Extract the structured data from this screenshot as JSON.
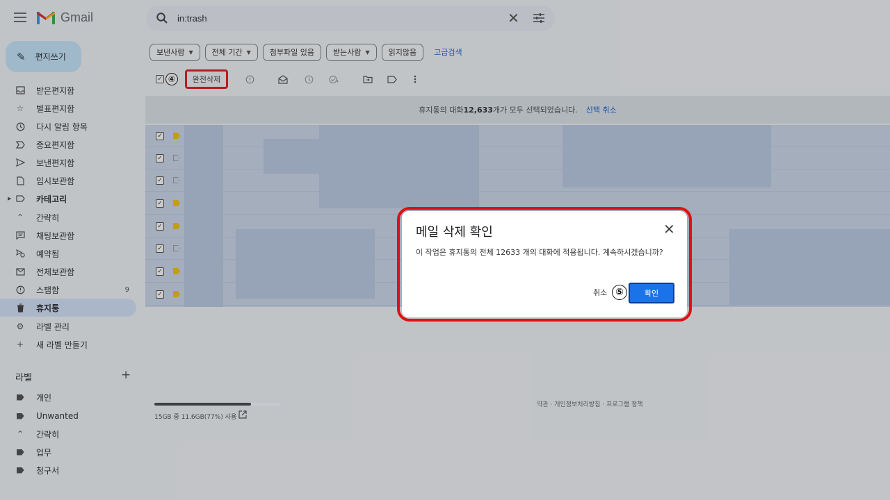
{
  "app": {
    "name": "Gmail"
  },
  "search": {
    "value": "in:trash"
  },
  "compose": {
    "label": "편지쓰기"
  },
  "nav": [
    {
      "label": "받은편지함",
      "icon": "inbox-icon"
    },
    {
      "label": "별표편지함",
      "icon": "star-icon"
    },
    {
      "label": "다시 알림 항목",
      "icon": "clock-icon"
    },
    {
      "label": "중요편지함",
      "icon": "important-icon"
    },
    {
      "label": "보낸편지함",
      "icon": "send-icon"
    },
    {
      "label": "임시보관함",
      "icon": "draft-icon"
    },
    {
      "label": "카테고리",
      "icon": "label-icon"
    },
    {
      "label": "간략히",
      "icon": "chevron-up-icon"
    },
    {
      "label": "채팅보관함",
      "icon": "chat-icon"
    },
    {
      "label": "예약됨",
      "icon": "scheduled-icon"
    },
    {
      "label": "전체보관함",
      "icon": "all-mail-icon"
    },
    {
      "label": "스팸함",
      "icon": "spam-icon",
      "count": "9"
    },
    {
      "label": "휴지통",
      "icon": "trash-icon"
    },
    {
      "label": "라벨 관리",
      "icon": "gear-icon"
    },
    {
      "label": "새 라벨 만들기",
      "icon": "plus-icon"
    }
  ],
  "labels": {
    "heading": "라벨",
    "items": [
      "개인",
      "Unwanted",
      "간략히",
      "업무",
      "청구서"
    ]
  },
  "filters": {
    "chips": [
      "보낸사람",
      "전체 기간",
      "첨부파일 있음",
      "받는사람",
      "읽지않음"
    ],
    "advanced": "고급검색"
  },
  "toolbar": {
    "delete_forever": "완전삭제",
    "step4": "④"
  },
  "banner": {
    "prefix": "휴지통의 대화 ",
    "count": "12,633",
    "suffix": "개가 모두 선택되었습니다.",
    "undo": "선택 취소"
  },
  "storage": {
    "text": "15GB 중 11.6GB(77%) 사용",
    "percent": 77
  },
  "footer": {
    "links": "약관 · 개인정보처리방침 · 프로그램 정책"
  },
  "dialog": {
    "title": "메일 삭제 확인",
    "message": "이 작업은 휴지통의 전체 12633 개의 대화에 적용됩니다. 계속하시겠습니까?",
    "cancel": "취소",
    "ok": "확인",
    "step5": "⑤"
  },
  "colors": {
    "accent": "#0b57d0",
    "highlight": "#e01010",
    "primary_button": "#1a73e8",
    "selection": "#c9d7ec"
  }
}
